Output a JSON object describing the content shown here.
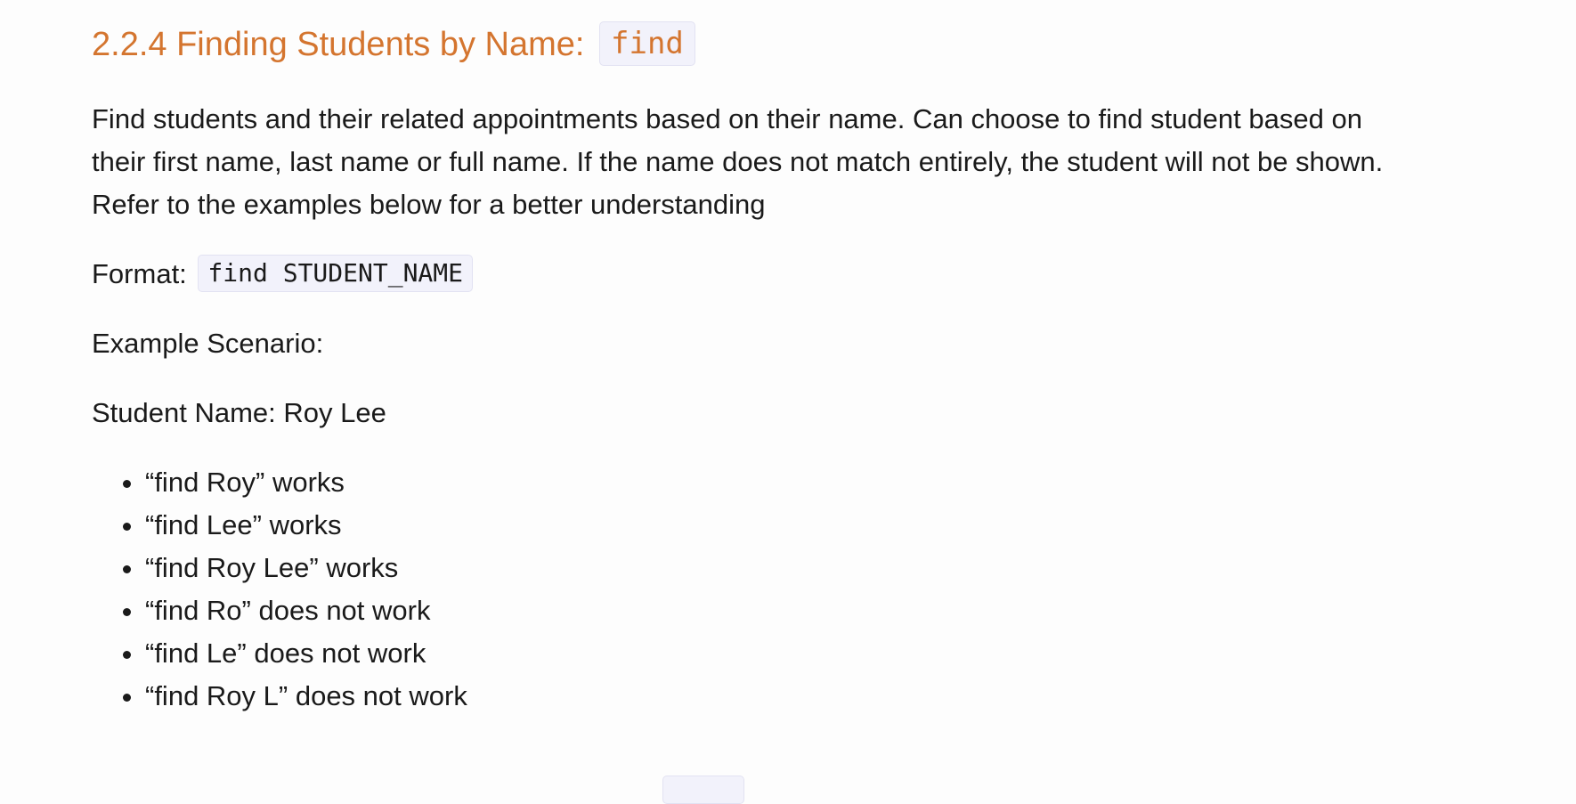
{
  "section": {
    "heading_text": "2.2.4 Finding Students by Name:",
    "heading_code": "find"
  },
  "intro": "Find students and their related appointments based on their name. Can choose to find student based on their first name, last name or full name. If the name does not match entirely, the student will not be shown. Refer to the examples below for a better understanding",
  "format": {
    "label": "Format:",
    "code": "find STUDENT_NAME"
  },
  "example_scenario": "Example Scenario:",
  "student_name": "Student Name: Roy Lee",
  "examples": [
    "“find Roy” works",
    "“find Lee” works",
    "“find Roy Lee” works",
    "“find Ro” does not work",
    "“find Le” does not work",
    "“find Roy L” does not work"
  ],
  "colors": {
    "heading": "#d4752f",
    "code_background": "#f2f2fb",
    "text": "#1a1a1a",
    "background": "#fdfdfd"
  }
}
